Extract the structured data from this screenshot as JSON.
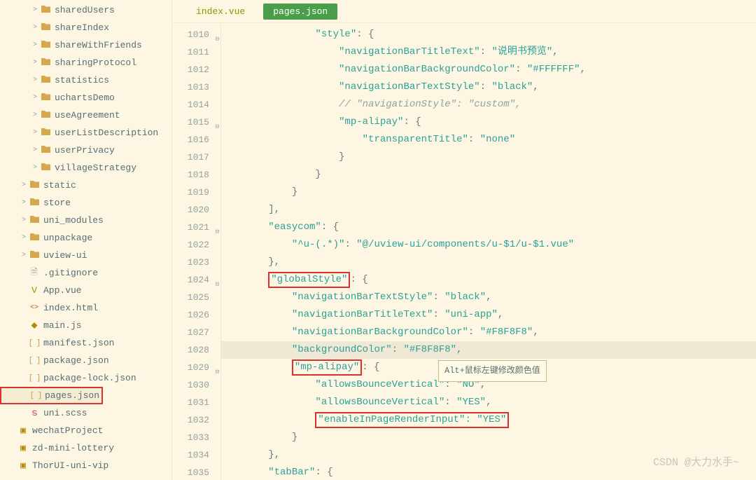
{
  "sidebar": {
    "items": [
      {
        "label": "sharedUsers",
        "type": "folder",
        "indent": 3,
        "arrow": ">"
      },
      {
        "label": "shareIndex",
        "type": "folder",
        "indent": 3,
        "arrow": ">"
      },
      {
        "label": "shareWithFriends",
        "type": "folder",
        "indent": 3,
        "arrow": ">"
      },
      {
        "label": "sharingProtocol",
        "type": "folder",
        "indent": 3,
        "arrow": ">"
      },
      {
        "label": "statistics",
        "type": "folder",
        "indent": 3,
        "arrow": ">"
      },
      {
        "label": "uchartsDemo",
        "type": "folder",
        "indent": 3,
        "arrow": ">"
      },
      {
        "label": "useAgreement",
        "type": "folder",
        "indent": 3,
        "arrow": ">"
      },
      {
        "label": "userListDescription",
        "type": "folder",
        "indent": 3,
        "arrow": ">"
      },
      {
        "label": "userPrivacy",
        "type": "folder",
        "indent": 3,
        "arrow": ">"
      },
      {
        "label": "villageStrategy",
        "type": "folder",
        "indent": 3,
        "arrow": ">"
      },
      {
        "label": "static",
        "type": "folder",
        "indent": 2,
        "arrow": ">"
      },
      {
        "label": "store",
        "type": "folder",
        "indent": 2,
        "arrow": ">"
      },
      {
        "label": "uni_modules",
        "type": "folder",
        "indent": 2,
        "arrow": ">"
      },
      {
        "label": "unpackage",
        "type": "folder",
        "indent": 2,
        "arrow": ">"
      },
      {
        "label": "uview-ui",
        "type": "folder",
        "indent": 2,
        "arrow": ">"
      },
      {
        "label": ".gitignore",
        "type": "file-txt",
        "indent": 2,
        "arrow": ""
      },
      {
        "label": "App.vue",
        "type": "file-vue",
        "indent": 2,
        "arrow": ""
      },
      {
        "label": "index.html",
        "type": "file-html",
        "indent": 2,
        "arrow": ""
      },
      {
        "label": "main.js",
        "type": "file-js",
        "indent": 2,
        "arrow": ""
      },
      {
        "label": "manifest.json",
        "type": "file-json",
        "indent": 2,
        "arrow": ""
      },
      {
        "label": "package.json",
        "type": "file-json",
        "indent": 2,
        "arrow": ""
      },
      {
        "label": "package-lock.json",
        "type": "file-json",
        "indent": 2,
        "arrow": ""
      },
      {
        "label": "pages.json",
        "type": "file-json",
        "indent": 2,
        "arrow": "",
        "selected": true
      },
      {
        "label": "uni.scss",
        "type": "file-scss",
        "indent": 2,
        "arrow": ""
      },
      {
        "label": "wechatProject",
        "type": "root",
        "indent": 1,
        "arrow": ""
      },
      {
        "label": "zd-mini-lottery",
        "type": "root",
        "indent": 1,
        "arrow": ""
      },
      {
        "label": "ThorUI-uni-vip",
        "type": "root",
        "indent": 1,
        "arrow": ""
      }
    ]
  },
  "tabs": [
    {
      "label": "index.vue",
      "active": false
    },
    {
      "label": "pages.json",
      "active": true
    }
  ],
  "code": {
    "startLine": 1010,
    "lines": [
      {
        "indent": 4,
        "fold": "⊟",
        "tokens": [
          [
            "key",
            "\"style\""
          ],
          [
            "punct",
            ": {"
          ]
        ]
      },
      {
        "indent": 5,
        "tokens": [
          [
            "key",
            "\"navigationBarTitleText\""
          ],
          [
            "punct",
            ": "
          ],
          [
            "str",
            "\"说明书预览\""
          ],
          [
            "punct",
            ","
          ]
        ]
      },
      {
        "indent": 5,
        "tokens": [
          [
            "key",
            "\"navigationBarBackgroundColor\""
          ],
          [
            "punct",
            ": "
          ],
          [
            "str",
            "\"#FFFFFF\""
          ],
          [
            "punct",
            ","
          ]
        ]
      },
      {
        "indent": 5,
        "tokens": [
          [
            "key",
            "\"navigationBarTextStyle\""
          ],
          [
            "punct",
            ": "
          ],
          [
            "str",
            "\"black\""
          ],
          [
            "punct",
            ","
          ]
        ]
      },
      {
        "indent": 5,
        "tokens": [
          [
            "comment",
            "// \"navigationStyle\": \"custom\","
          ]
        ]
      },
      {
        "indent": 5,
        "fold": "⊟",
        "tokens": [
          [
            "key",
            "\"mp-alipay\""
          ],
          [
            "punct",
            ": {"
          ]
        ]
      },
      {
        "indent": 6,
        "tokens": [
          [
            "key",
            "\"transparentTitle\""
          ],
          [
            "punct",
            ": "
          ],
          [
            "str",
            "\"none\""
          ]
        ]
      },
      {
        "indent": 5,
        "tokens": [
          [
            "punct",
            "}"
          ]
        ]
      },
      {
        "indent": 4,
        "tokens": [
          [
            "punct",
            "}"
          ]
        ]
      },
      {
        "indent": 3,
        "tokens": [
          [
            "punct",
            "}"
          ]
        ]
      },
      {
        "indent": 2,
        "tokens": [
          [
            "punct",
            "],"
          ]
        ]
      },
      {
        "indent": 2,
        "fold": "⊟",
        "tokens": [
          [
            "key",
            "\"easycom\""
          ],
          [
            "punct",
            ": {"
          ]
        ]
      },
      {
        "indent": 3,
        "tokens": [
          [
            "key",
            "\"^u-(.*)\""
          ],
          [
            "punct",
            ": "
          ],
          [
            "str",
            "\"@/uview-ui/components/u-$1/u-$1.vue\""
          ]
        ]
      },
      {
        "indent": 2,
        "tokens": [
          [
            "punct",
            "},"
          ]
        ]
      },
      {
        "indent": 2,
        "fold": "⊟",
        "tokens": [
          [
            "boxkey",
            "\"globalStyle\""
          ],
          [
            "punct",
            ": {"
          ]
        ]
      },
      {
        "indent": 3,
        "tokens": [
          [
            "key",
            "\"navigationBarTextStyle\""
          ],
          [
            "punct",
            ": "
          ],
          [
            "str",
            "\"black\""
          ],
          [
            "punct",
            ","
          ]
        ]
      },
      {
        "indent": 3,
        "tokens": [
          [
            "key",
            "\"navigationBarTitleText\""
          ],
          [
            "punct",
            ": "
          ],
          [
            "str",
            "\"uni-app\""
          ],
          [
            "punct",
            ","
          ]
        ]
      },
      {
        "indent": 3,
        "tokens": [
          [
            "key",
            "\"navigationBarBackgroundColor\""
          ],
          [
            "punct",
            ": "
          ],
          [
            "str",
            "\"#F8F8F8\""
          ],
          [
            "punct",
            ","
          ]
        ]
      },
      {
        "indent": 3,
        "hl": true,
        "tokens": [
          [
            "key",
            "\"backgroundColor\""
          ],
          [
            "punct",
            ": "
          ],
          [
            "str",
            "\"#F8F8F8\""
          ],
          [
            "punct",
            ","
          ]
        ]
      },
      {
        "indent": 3,
        "fold": "⊟",
        "tokens": [
          [
            "boxkey",
            "\"mp-alipay\""
          ],
          [
            "punct",
            ": {"
          ]
        ],
        "tooltip": "Alt+鼠标左键修改颜色值"
      },
      {
        "indent": 4,
        "tokens": [
          [
            "key",
            "\"allowsBounceVertical\""
          ],
          [
            "punct",
            ": "
          ],
          [
            "str",
            "\"NO\""
          ],
          [
            "punct",
            ","
          ]
        ]
      },
      {
        "indent": 4,
        "tokens": [
          [
            "key",
            "\"allowsBounceVertical\""
          ],
          [
            "punct",
            ": "
          ],
          [
            "str",
            "\"YES\""
          ],
          [
            "punct",
            ","
          ]
        ]
      },
      {
        "indent": 4,
        "tokens": [
          [
            "boxpair",
            "\"enableInPageRenderInput\": \"YES\""
          ]
        ]
      },
      {
        "indent": 3,
        "tokens": [
          [
            "punct",
            "}"
          ]
        ]
      },
      {
        "indent": 2,
        "tokens": [
          [
            "punct",
            "},"
          ]
        ]
      },
      {
        "indent": 2,
        "tokens": [
          [
            "key",
            "\"tabBar\""
          ],
          [
            "punct",
            ": {"
          ]
        ]
      }
    ]
  },
  "watermark": "CSDN @大力水手~"
}
